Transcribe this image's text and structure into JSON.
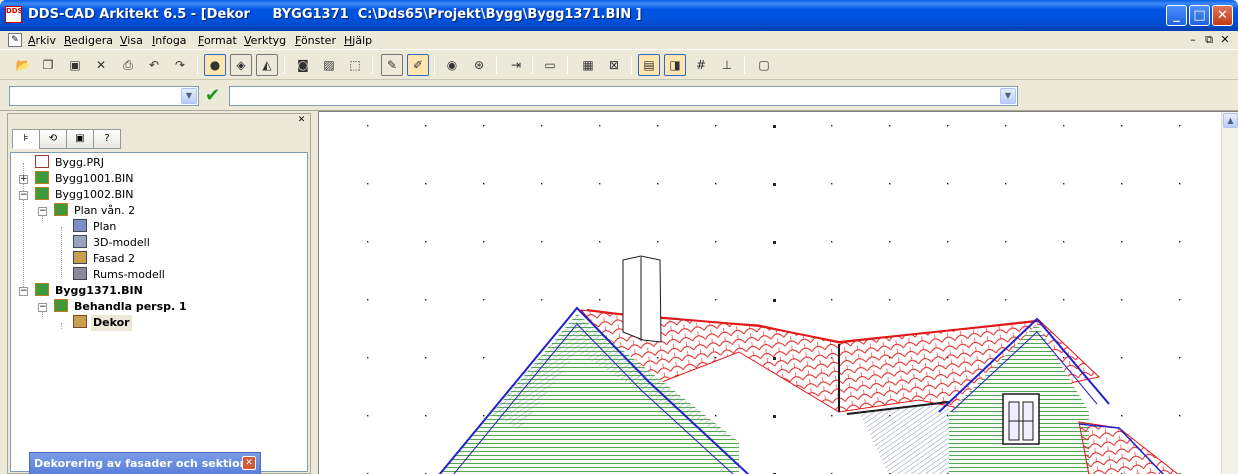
{
  "window": {
    "title": "DDS-CAD Arkitekt 6.5 - [Dekor     BYGG1371  C:\\Dds65\\Projekt\\Bygg\\Bygg1371.BIN ]",
    "app_icon_text": "DDS"
  },
  "menu": {
    "items": [
      "Arkiv",
      "Redigera",
      "Visa",
      "Infoga",
      "Format",
      "Verktyg",
      "Fönster",
      "Hjälp"
    ]
  },
  "toolbar": {
    "icons": [
      "open-folder-icon",
      "new-project-icon",
      "save-icon",
      "delete-icon",
      "print-icon",
      "undo-icon",
      "redo-icon",
      "render-sphere-icon",
      "render-box-icon",
      "render-scene-icon",
      "view-window-icon",
      "view-image-icon",
      "select-area-icon",
      "pencil-icon",
      "eraser-icon",
      "eye-icon",
      "measure-icon",
      "insert-icon",
      "text-box-icon",
      "image-icon",
      "crop-icon",
      "plan-view-icon",
      "snap-icon",
      "grid-icon",
      "ruler-icon",
      "fullscreen-icon"
    ]
  },
  "command_bar": {
    "left_combo_value": "",
    "right_combo_value": ""
  },
  "panel": {
    "tabs": [
      "tree-tab",
      "layers-tab",
      "view-tab",
      "help-tab"
    ],
    "tree": [
      {
        "label": "Bygg.PRJ",
        "icon": "project-icon",
        "level": 0
      },
      {
        "label": "Bygg1001.BIN",
        "icon": "building-icon",
        "level": 0,
        "expander": "+"
      },
      {
        "label": "Bygg1002.BIN",
        "icon": "building-icon",
        "level": 0,
        "expander": "−"
      },
      {
        "label": "Plan vån. 2",
        "icon": "floor-icon",
        "level": 1,
        "expander": "−"
      },
      {
        "label": "Plan",
        "icon": "plan-icon",
        "level": 2
      },
      {
        "label": "3D-modell",
        "icon": "model-3d-icon",
        "level": 2
      },
      {
        "label": "Fasad 2",
        "icon": "facade-icon",
        "level": 2
      },
      {
        "label": "Rums-modell",
        "icon": "room-model-icon",
        "level": 2
      },
      {
        "label": "Bygg1371.BIN",
        "icon": "building-icon",
        "level": 0,
        "expander": "−",
        "bold": true
      },
      {
        "label": "Behandla persp. 1",
        "icon": "perspective-icon",
        "level": 1,
        "expander": "−",
        "bold": true
      },
      {
        "label": "Dekor",
        "icon": "house-decor-icon",
        "level": 2,
        "bold": true,
        "selected": true
      }
    ]
  },
  "dialog": {
    "title": "Dekorering av fasader och sektion"
  },
  "colors": {
    "titlebar": "#0055e5",
    "roof_tiles": "#e01818",
    "roof_edge": "#2222cc",
    "wall_siding": "#2f8f2f",
    "gable_hatch": "#6a7a8a"
  }
}
